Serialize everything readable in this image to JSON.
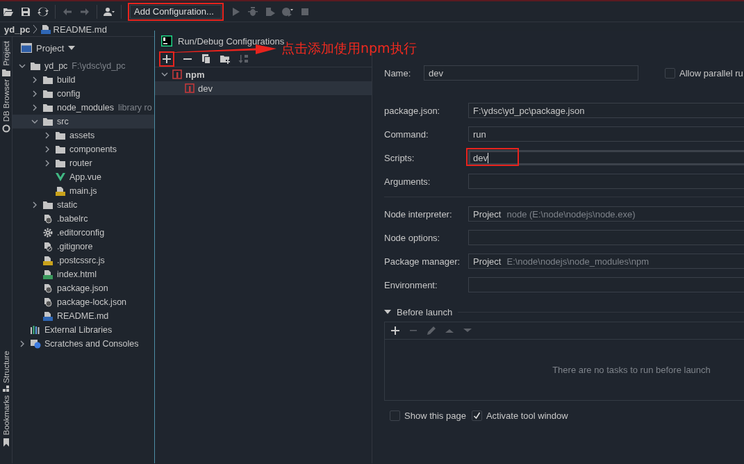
{
  "toolbar": {
    "add_configuration": {
      "label": "Add Configuration...",
      "highlighted": true
    }
  },
  "breadcrumb": [
    "yd_pc",
    "README.md"
  ],
  "side_stripe": {
    "top": [
      {
        "label": "Project",
        "selected": true
      },
      {
        "label": "DB Browser",
        "selected": false
      }
    ],
    "bottom": [
      {
        "label": "Structure",
        "selected": false
      },
      {
        "label": "Bookmarks",
        "selected": false
      }
    ]
  },
  "project_panel": {
    "title": "Project",
    "tree": [
      {
        "label": "yd_pc",
        "hint": "F:\\ydsc\\yd_pc",
        "kind": "folder",
        "expanded": true,
        "selected": false,
        "children": [
          {
            "label": "build",
            "kind": "folder",
            "expanded": false,
            "selected": false
          },
          {
            "label": "config",
            "kind": "folder",
            "expanded": false,
            "selected": false
          },
          {
            "label": "node_modules",
            "hint": "library ro",
            "kind": "folder",
            "expanded": false,
            "selected": false
          },
          {
            "label": "src",
            "kind": "folder",
            "expanded": true,
            "selected": true,
            "children": [
              {
                "label": "assets",
                "kind": "folder",
                "expanded": false,
                "selected": false
              },
              {
                "label": "components",
                "kind": "folder",
                "expanded": false,
                "selected": false
              },
              {
                "label": "router",
                "kind": "folder",
                "expanded": false,
                "selected": false
              },
              {
                "label": "App.vue",
                "kind": "vue",
                "selected": false
              },
              {
                "label": "main.js",
                "kind": "js",
                "selected": false
              }
            ]
          },
          {
            "label": "static",
            "kind": "folder",
            "expanded": false,
            "selected": false
          },
          {
            "label": ".babelrc",
            "kind": "config",
            "selected": false
          },
          {
            "label": ".editorconfig",
            "kind": "gear",
            "selected": false
          },
          {
            "label": ".gitignore",
            "kind": "ignore",
            "selected": false
          },
          {
            "label": ".postcssrc.js",
            "kind": "js",
            "selected": false
          },
          {
            "label": "index.html",
            "kind": "html",
            "selected": false
          },
          {
            "label": "package.json",
            "kind": "config",
            "selected": false
          },
          {
            "label": "package-lock.json",
            "kind": "config",
            "selected": false
          },
          {
            "label": "README.md",
            "kind": "md",
            "selected": false
          }
        ]
      },
      {
        "label": "External Libraries",
        "kind": "libraries",
        "selected": false
      },
      {
        "label": "Scratches and Consoles",
        "kind": "scratches",
        "expanded": false,
        "selected": false
      }
    ]
  },
  "dialog": {
    "title": "Run/Debug Configurations",
    "add_highlighted": true,
    "tree": [
      {
        "label": "npm",
        "kind": "npm",
        "expanded": true,
        "selected": false,
        "children": [
          {
            "label": "dev",
            "kind": "npm",
            "selected": true
          }
        ]
      }
    ],
    "name_field": {
      "label": "Name:",
      "value": "dev"
    },
    "allow_parallel": {
      "label": "Allow parallel ru",
      "checked": false
    },
    "field_groups": [
      [
        {
          "label": "package.json:",
          "value": "F:\\ydsc\\yd_pc\\package.json"
        },
        {
          "label": "Command:",
          "value": "run"
        },
        {
          "label": "Scripts:",
          "value": "dev",
          "focused": true,
          "highlighted": true
        },
        {
          "label": "Arguments:"
        }
      ],
      [
        {
          "label": "Node interpreter:",
          "value": "Project",
          "hint": "node (E:\\node\\nodejs\\node.exe)"
        },
        {
          "label": "Node options:"
        },
        {
          "label": "Package manager:",
          "value": "Project",
          "hint": "E:\\node\\nodejs\\node_modules\\npm"
        },
        {
          "label": "Environment:"
        }
      ]
    ],
    "before_launch": {
      "title": "Before launch",
      "expanded": true,
      "empty_text": "There are no tasks to run before launch"
    },
    "options": [
      {
        "label": "Show this page",
        "checked": false
      },
      {
        "label": "Activate tool window",
        "checked": true
      }
    ]
  },
  "annotation": {
    "text": "点击添加使用npm执行"
  }
}
